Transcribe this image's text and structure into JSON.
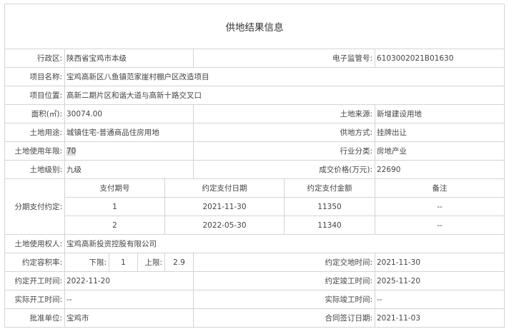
{
  "title": "供地结果信息",
  "rows": {
    "district": {
      "label": "行政区:",
      "value": "陕西省宝鸡市本级"
    },
    "supervision_no": {
      "label": "电子监管号:",
      "value": "6103002021B01630"
    },
    "project_name": {
      "label": "项目名称:",
      "value": "宝鸡高新区八鱼镇范家崖村棚户区改造项目"
    },
    "project_location": {
      "label": "项目位置:",
      "value": "高新二期片区和谐大道与高新十路交叉口"
    },
    "area": {
      "label": "面积(㎡):",
      "value": "30074.00"
    },
    "land_source": {
      "label": "土地来源:",
      "value": "新增建设用地"
    },
    "land_use": {
      "label": "土地用途:",
      "value": "城镇住宅-普通商品住房用地"
    },
    "supply_method": {
      "label": "供地方式:",
      "value": "挂牌出让"
    },
    "use_years": {
      "label": "土地使用年限:",
      "value": "70"
    },
    "industry": {
      "label": "行业分类:",
      "value": "房地产业"
    },
    "land_grade": {
      "label": "土地级别:",
      "value": "九级"
    },
    "price": {
      "label": "成交价格(万元):",
      "value": "22690"
    },
    "payment": {
      "label": "分期支付约定:",
      "headers": [
        "支付期号",
        "约定支付日期",
        "约定支付金额",
        "备注"
      ],
      "items": [
        {
          "period": "1",
          "date": "2021-11-30",
          "amount": "11350",
          "note": "--"
        },
        {
          "period": "2",
          "date": "2022-05-30",
          "amount": "11340",
          "note": "--"
        }
      ]
    },
    "land_user": {
      "label": "土地使用权人:",
      "value": "宝鸡高新投资控股有限公司"
    },
    "far": {
      "label": "约定容积率:",
      "lower_label": "下限:",
      "lower": "1",
      "upper_label": "上限:",
      "upper": "2.9"
    },
    "delivery_time": {
      "label": "约定交地时间:",
      "value": "2021-11-30"
    },
    "start_time": {
      "label": "约定开工时间:",
      "value": "2022-11-20"
    },
    "finish_time": {
      "label": "约定竣工时间:",
      "value": "2025-11-20"
    },
    "actual_start": {
      "label": "实际开工时间:",
      "value": "--"
    },
    "actual_finish": {
      "label": "实际竣工时间:",
      "value": "--"
    },
    "approver": {
      "label": "批准单位:",
      "value": "宝鸡市"
    },
    "contract_date": {
      "label": "合同签订日期:",
      "value": "2021-11-03"
    }
  }
}
